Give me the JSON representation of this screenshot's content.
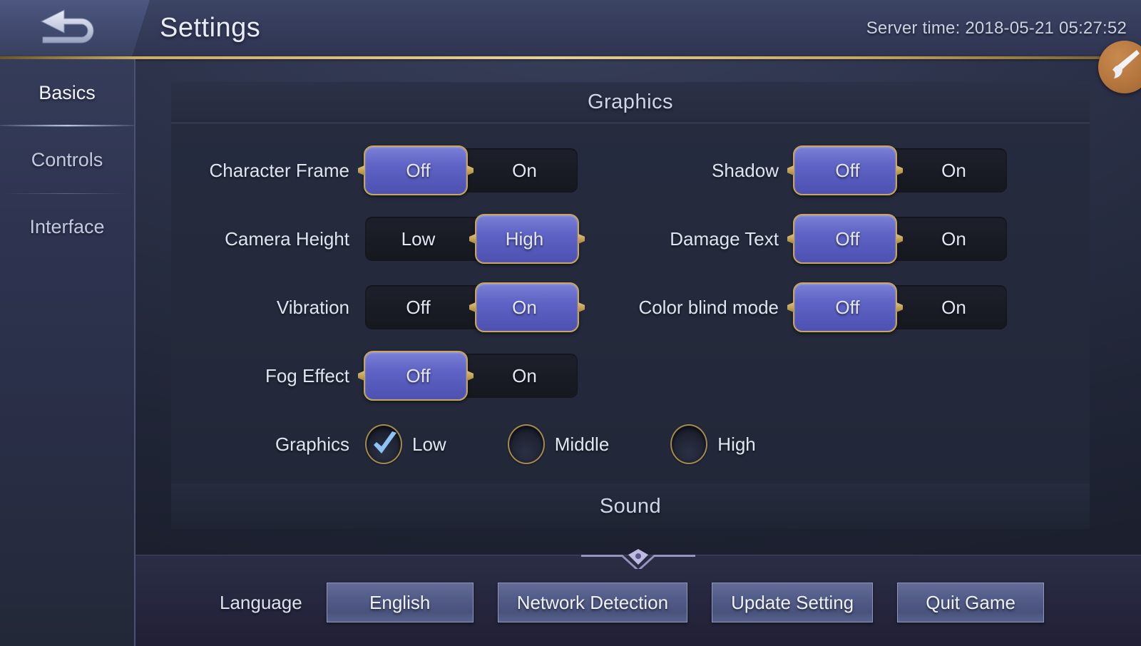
{
  "header": {
    "title": "Settings",
    "server_time": "Server time: 2018-05-21 05:27:52",
    "back_icon": "back-arrow-icon",
    "corner_icon": "brush-icon"
  },
  "sidebar": {
    "items": [
      {
        "label": "Basics",
        "active": true
      },
      {
        "label": "Controls",
        "active": false
      },
      {
        "label": "Interface",
        "active": false
      }
    ]
  },
  "graphics": {
    "title": "Graphics",
    "left_rows": [
      {
        "label": "Character Frame",
        "options": [
          "Off",
          "On"
        ],
        "selected": 0
      },
      {
        "label": "Camera Height",
        "options": [
          "Low",
          "High"
        ],
        "selected": 1
      },
      {
        "label": "Vibration",
        "options": [
          "Off",
          "On"
        ],
        "selected": 1
      },
      {
        "label": "Fog Effect",
        "options": [
          "Off",
          "On"
        ],
        "selected": 0
      }
    ],
    "right_rows": [
      {
        "label": "Shadow",
        "options": [
          "Off",
          "On"
        ],
        "selected": 0
      },
      {
        "label": "Damage Text",
        "options": [
          "Off",
          "On"
        ],
        "selected": 0
      },
      {
        "label": "Color blind mode",
        "options": [
          "Off",
          "On"
        ],
        "selected": 0
      }
    ],
    "quality": {
      "label": "Graphics",
      "options": [
        "Low",
        "Middle",
        "High"
      ],
      "selected": 0
    }
  },
  "sound": {
    "title": "Sound"
  },
  "bottom": {
    "language_label": "Language",
    "buttons": [
      "English",
      "Network Detection",
      "Update Setting",
      "Quit Game"
    ]
  },
  "colors": {
    "accent_blue": "#5d62c4",
    "gold": "#c7a65c",
    "track_dark": "#1b1d28",
    "text": "#e3e7f3",
    "badge_orange": "#b4763d"
  }
}
